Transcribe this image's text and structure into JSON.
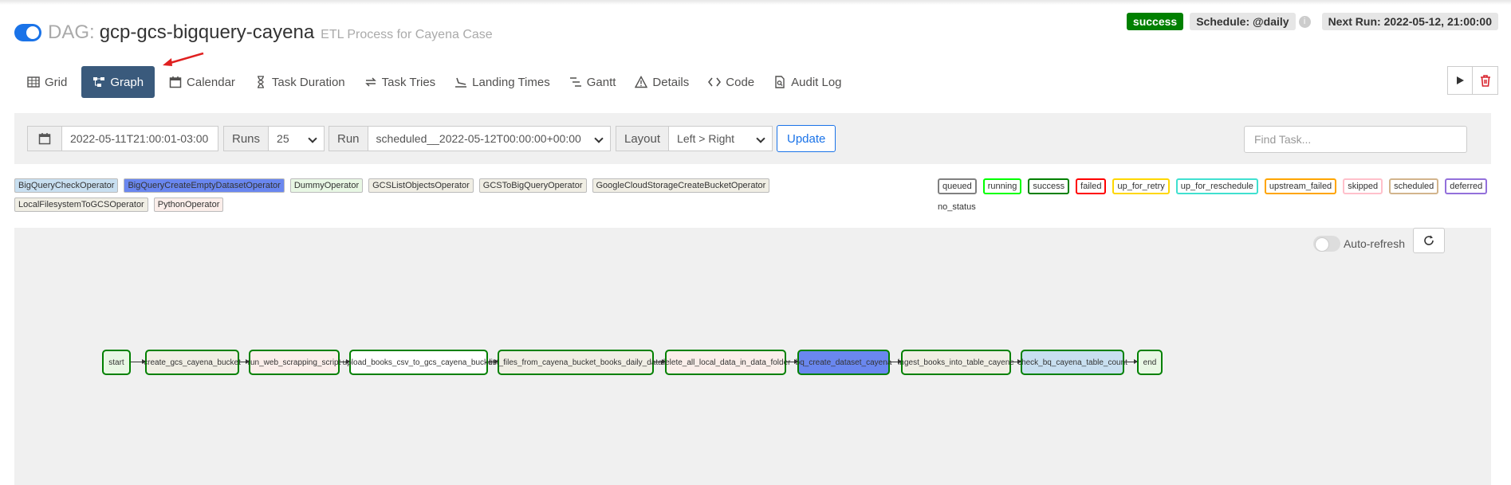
{
  "header": {
    "dag_label": "DAG:",
    "dag_id": "gcp-gcs-bigquery-cayena",
    "description": "ETL Process for Cayena Case",
    "status": "success",
    "schedule": "Schedule: @daily",
    "info_icon": "i",
    "next_run": "Next Run: 2022-05-12, 21:00:00"
  },
  "nav": {
    "grid": "Grid",
    "graph": "Graph",
    "calendar": "Calendar",
    "task_duration": "Task Duration",
    "task_tries": "Task Tries",
    "landing_times": "Landing Times",
    "gantt": "Gantt",
    "details": "Details",
    "code": "Code",
    "audit_log": "Audit Log"
  },
  "toolbar": {
    "base_date": "2022-05-11T21:00:01-03:00",
    "runs_label": "Runs",
    "runs_value": "25",
    "run_label": "Run",
    "run_value": "scheduled__2022-05-12T00:00:00+00:00",
    "layout_label": "Layout",
    "layout_value": "Left > Right",
    "update_label": "Update",
    "find_placeholder": "Find Task..."
  },
  "operators": [
    {
      "name": "BigQueryCheckOperator",
      "color": "#c8dff0"
    },
    {
      "name": "BigQueryCreateEmptyDatasetOperator",
      "color": "#6a87ef"
    },
    {
      "name": "DummyOperator",
      "color": "#e8f7e4"
    },
    {
      "name": "GCSListObjectsOperator",
      "color": "#f0eee4"
    },
    {
      "name": "GCSToBigQueryOperator",
      "color": "#f0eee4"
    },
    {
      "name": "GoogleCloudStorageCreateBucketOperator",
      "color": "#f0eee4"
    },
    {
      "name": "LocalFilesystemToGCSOperator",
      "color": "#f0eee4"
    },
    {
      "name": "PythonOperator",
      "color": "#fbeeea"
    }
  ],
  "states": [
    {
      "name": "queued",
      "color": "#808080"
    },
    {
      "name": "running",
      "color": "#00ff00"
    },
    {
      "name": "success",
      "color": "#008000"
    },
    {
      "name": "failed",
      "color": "#ff0000"
    },
    {
      "name": "up_for_retry",
      "color": "#ffd700"
    },
    {
      "name": "up_for_reschedule",
      "color": "#40e0d0"
    },
    {
      "name": "upstream_failed",
      "color": "#ffa500"
    },
    {
      "name": "skipped",
      "color": "#ffc0cb"
    },
    {
      "name": "scheduled",
      "color": "#d2b48c"
    },
    {
      "name": "deferred",
      "color": "#9370db"
    }
  ],
  "no_status": "no_status",
  "graph": {
    "auto_refresh": "Auto-refresh",
    "tasks": [
      {
        "name": "start",
        "color": "#e8f7e4"
      },
      {
        "name": "create_gcs_cayena_bucket",
        "color": "#f0eee4"
      },
      {
        "name": "run_web_scrapping_script",
        "color": "#fbeeea"
      },
      {
        "name": "upload_books_csv_to_gcs_cayena_bucket",
        "color": "#ffffff"
      },
      {
        "name": "list_files_from_cayena_bucket_books_daily_data",
        "color": "#f0eee4"
      },
      {
        "name": "delete_all_local_data_in_data_folder",
        "color": "#fbeeea"
      },
      {
        "name": "bq_create_dataset_cayena",
        "color": "#6a87ef"
      },
      {
        "name": "ingest_books_into_table_cayene",
        "color": "#f0eee4"
      },
      {
        "name": "check_bq_cayena_table_count",
        "color": "#c8dff0"
      },
      {
        "name": "end",
        "color": "#e8f7e4"
      }
    ]
  }
}
